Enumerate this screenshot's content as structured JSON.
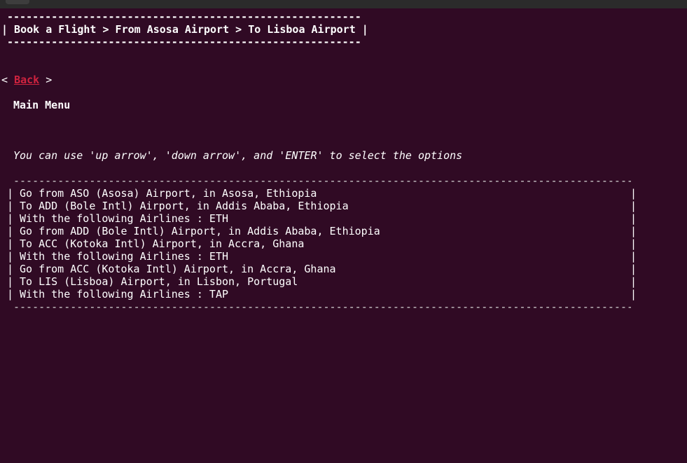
{
  "header": {
    "border": "--------------------------------------------------------",
    "breadcrumb": "| Book a Flight > From Asosa Airport > To Lisboa Airport |"
  },
  "nav": {
    "back_open": "< ",
    "back_label": "Back",
    "back_close": " >"
  },
  "menu": {
    "main_menu_label": "Main Menu"
  },
  "hint": "You can use 'up arrow', 'down arrow', and 'ENTER' to select the options",
  "itinerary": {
    "border": "-------------------------------------------------------------------------------------------------------------",
    "bar": "|",
    "lines": [
      "Go from ASO (Asosa) Airport, in Asosa, Ethiopia",
      "To ADD (Bole Intl) Airport, in Addis Ababa, Ethiopia",
      "With the following Airlines : ETH",
      "Go from ADD (Bole Intl) Airport, in Addis Ababa, Ethiopia",
      "To ACC (Kotoka Intl) Airport, in Accra, Ghana",
      "With the following Airlines : ETH",
      "Go from ACC (Kotoka Intl) Airport, in Accra, Ghana",
      "To LIS (Lisboa) Airport, in Lisbon, Portugal",
      "With the following Airlines : TAP"
    ]
  },
  "colors": {
    "background": "#300a24",
    "link": "#d0233f",
    "text": "#ffffff"
  }
}
